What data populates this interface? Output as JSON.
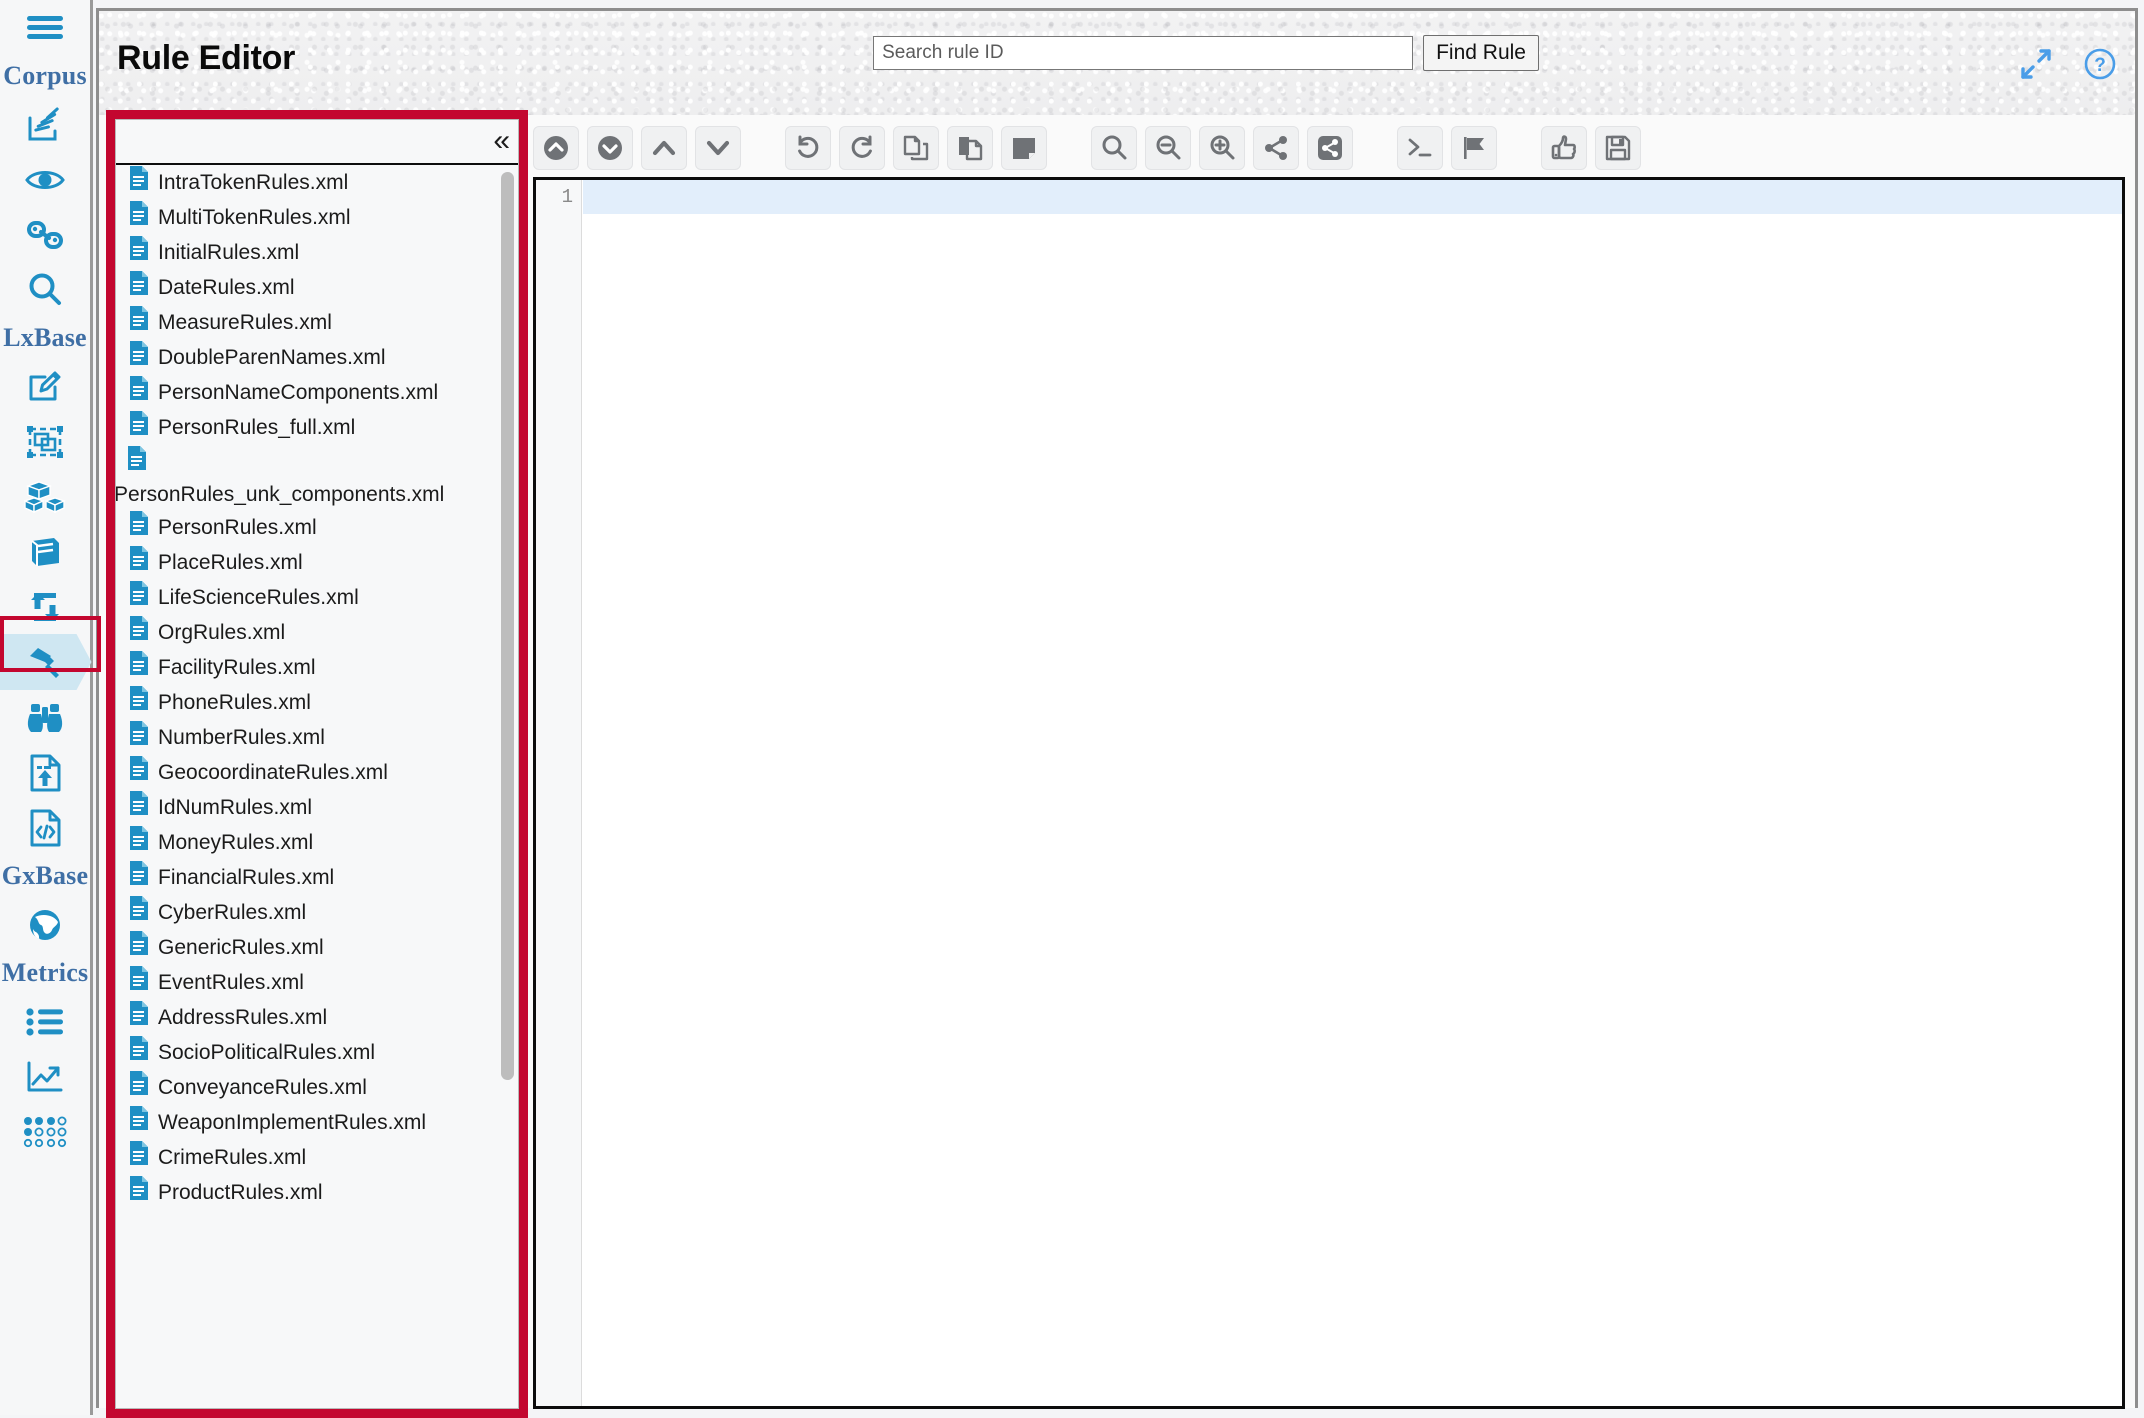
{
  "rail": {
    "menu_icon": "hamburger-menu-icon",
    "sections": [
      {
        "label": "Corpus"
      },
      {
        "label": "LxBase"
      },
      {
        "label": "GxBase"
      },
      {
        "label": "Metrics"
      }
    ],
    "items": [
      {
        "name": "hamburger-menu",
        "icon": "hamburger-menu-icon",
        "selected": false
      },
      {
        "name": "section-corpus",
        "label": "Corpus",
        "type": "label"
      },
      {
        "name": "corpus-documents",
        "icon": "documents-stack-icon",
        "selected": false
      },
      {
        "name": "corpus-view",
        "icon": "eye-icon",
        "selected": false
      },
      {
        "name": "corpus-link",
        "icon": "link-chain-icon",
        "selected": false
      },
      {
        "name": "corpus-search",
        "icon": "magnifier-icon",
        "selected": false
      },
      {
        "name": "section-lxbase",
        "label": "LxBase",
        "type": "label"
      },
      {
        "name": "lexicon-edit",
        "icon": "edit-pencil-square-icon",
        "selected": false
      },
      {
        "name": "lexicon-group",
        "icon": "group-select-icon",
        "selected": false
      },
      {
        "name": "lexicon-blocks",
        "icon": "blocks-cubes-icon",
        "selected": false
      },
      {
        "name": "lexicon-book",
        "icon": "book-icon",
        "selected": false
      },
      {
        "name": "lexicon-transform",
        "icon": "transform-arrows-icon",
        "selected": false
      },
      {
        "name": "rule-editor",
        "icon": "hammer-icon",
        "selected": true
      },
      {
        "name": "binoculars",
        "icon": "binoculars-icon",
        "selected": false
      },
      {
        "name": "file-upload",
        "icon": "file-upload-icon",
        "selected": false
      },
      {
        "name": "file-code",
        "icon": "file-code-icon",
        "selected": false
      },
      {
        "name": "section-gxbase",
        "label": "GxBase",
        "type": "label"
      },
      {
        "name": "globe",
        "icon": "globe-icon",
        "selected": false
      },
      {
        "name": "section-metrics",
        "label": "Metrics",
        "type": "label"
      },
      {
        "name": "metrics-list",
        "icon": "list-icon",
        "selected": false
      },
      {
        "name": "metrics-chart",
        "icon": "trend-chart-icon",
        "selected": false
      },
      {
        "name": "metrics-matrix",
        "icon": "dot-matrix-icon",
        "selected": false
      }
    ]
  },
  "header": {
    "title": "Rule Editor",
    "search": {
      "placeholder": "Search rule ID",
      "value": ""
    },
    "find_rule_label": "Find Rule",
    "expand_icon": "expand-arrows-icon",
    "help_icon": "help-question-icon"
  },
  "file_panel": {
    "collapse_label": "«",
    "files": [
      {
        "name": "IntraTokenRules.xml",
        "wrapped": false
      },
      {
        "name": "MultiTokenRules.xml",
        "wrapped": false
      },
      {
        "name": "InitialRules.xml",
        "wrapped": false
      },
      {
        "name": "DateRules.xml",
        "wrapped": false
      },
      {
        "name": "MeasureRules.xml",
        "wrapped": false
      },
      {
        "name": "DoubleParenNames.xml",
        "wrapped": false
      },
      {
        "name": "PersonNameComponents.xml",
        "wrapped": false
      },
      {
        "name": "PersonRules_full.xml",
        "wrapped": false
      },
      {
        "name": "PersonRules_unk_components.xml",
        "wrapped": true
      },
      {
        "name": "PersonRules.xml",
        "wrapped": false
      },
      {
        "name": "PlaceRules.xml",
        "wrapped": false
      },
      {
        "name": "LifeScienceRules.xml",
        "wrapped": false
      },
      {
        "name": "OrgRules.xml",
        "wrapped": false
      },
      {
        "name": "FacilityRules.xml",
        "wrapped": false
      },
      {
        "name": "PhoneRules.xml",
        "wrapped": false
      },
      {
        "name": "NumberRules.xml",
        "wrapped": false
      },
      {
        "name": "GeocoordinateRules.xml",
        "wrapped": false
      },
      {
        "name": "IdNumRules.xml",
        "wrapped": false
      },
      {
        "name": "MoneyRules.xml",
        "wrapped": false
      },
      {
        "name": "FinancialRules.xml",
        "wrapped": false
      },
      {
        "name": "CyberRules.xml",
        "wrapped": false
      },
      {
        "name": "GenericRules.xml",
        "wrapped": false
      },
      {
        "name": "EventRules.xml",
        "wrapped": false
      },
      {
        "name": "AddressRules.xml",
        "wrapped": false
      },
      {
        "name": "SocioPoliticalRules.xml",
        "wrapped": false
      },
      {
        "name": "ConveyanceRules.xml",
        "wrapped": false
      },
      {
        "name": "WeaponImplementRules.xml",
        "wrapped": false
      },
      {
        "name": "CrimeRules.xml",
        "wrapped": false
      },
      {
        "name": "ProductRules.xml",
        "wrapped": false
      }
    ]
  },
  "editor_toolbar": {
    "buttons": [
      {
        "name": "move-to-top-button",
        "icon": "circle-chevron-up-icon"
      },
      {
        "name": "move-to-bottom-button",
        "icon": "circle-chevron-down-icon"
      },
      {
        "name": "move-up-button",
        "icon": "chevron-up-icon"
      },
      {
        "name": "move-down-button",
        "icon": "chevron-down-icon"
      },
      {
        "name": "undo-button",
        "icon": "undo-arrow-icon"
      },
      {
        "name": "redo-button",
        "icon": "redo-arrow-icon"
      },
      {
        "name": "copy-button",
        "icon": "copy-pages-icon"
      },
      {
        "name": "paste-button",
        "icon": "paste-page-icon"
      },
      {
        "name": "note-button",
        "icon": "filled-note-icon"
      },
      {
        "name": "find-button",
        "icon": "magnifier-icon"
      },
      {
        "name": "zoom-out-button",
        "icon": "magnifier-minus-icon"
      },
      {
        "name": "zoom-in-button",
        "icon": "magnifier-plus-icon"
      },
      {
        "name": "share-button",
        "icon": "share-nodes-icon"
      },
      {
        "name": "share-filled-button",
        "icon": "share-nodes-filled-icon"
      },
      {
        "name": "console-button",
        "icon": "terminal-prompt-icon"
      },
      {
        "name": "flag-button",
        "icon": "flag-icon"
      },
      {
        "name": "approve-button",
        "icon": "thumbs-up-icon"
      },
      {
        "name": "save-button",
        "icon": "floppy-disk-save-icon"
      }
    ]
  },
  "editor": {
    "lines": [
      {
        "number": "1",
        "text": "",
        "active": true
      }
    ]
  },
  "colors": {
    "rail_icon_blue": "#1f8fc4",
    "rail_label_blue": "#3f6fa5",
    "selected_chevron": "#cfe7f2",
    "annotation_red": "#c3072f",
    "toolbar_icon_gray": "#6f7276",
    "active_line_blue": "#e2eefb",
    "header_accent_blue": "#4a9de8"
  }
}
